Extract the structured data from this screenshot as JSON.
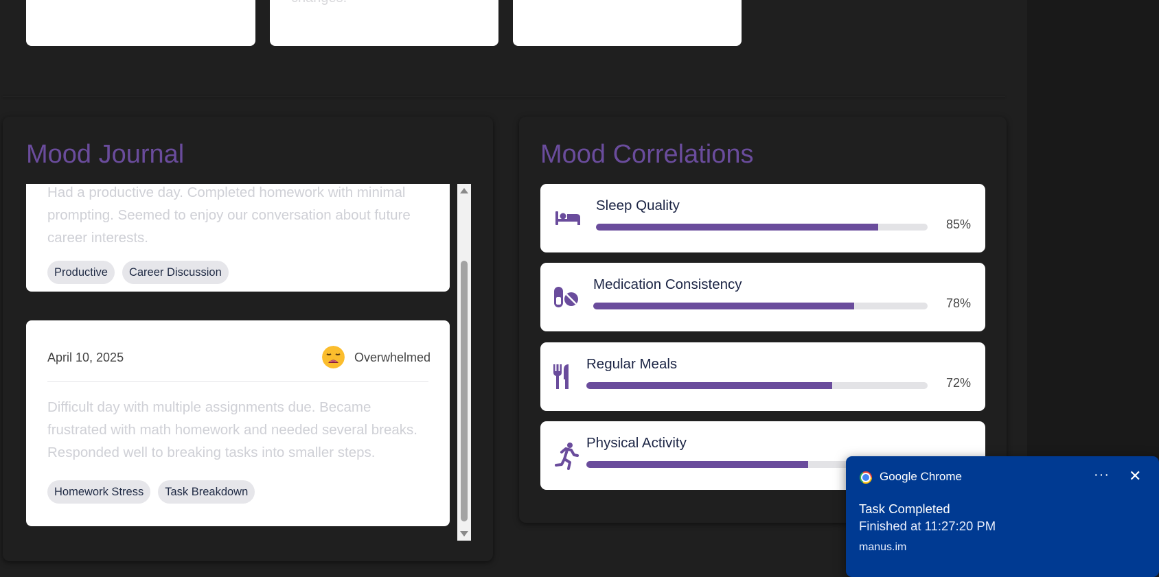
{
  "top_cards": {
    "clip_text": "changes."
  },
  "journal": {
    "title": "Mood Journal",
    "entries": [
      {
        "text": "Had a productive day. Completed homework with minimal prompting. Seemed to enjoy our conversation about future career interests.",
        "tags": [
          "Productive",
          "Career Discussion"
        ]
      },
      {
        "date": "April 10, 2025",
        "mood": "Overwhelmed",
        "text": "Difficult day with multiple assignments due. Became frustrated with math homework and needed several breaks. Responded well to breaking tasks into smaller steps.",
        "tags": [
          "Homework Stress",
          "Task Breakdown"
        ]
      }
    ]
  },
  "correlations": {
    "title": "Mood Correlations",
    "items": [
      {
        "label": "Sleep Quality",
        "percent_text": "85%",
        "value": 0.85,
        "icon": "bed-icon"
      },
      {
        "label": "Medication Consistency",
        "percent_text": "78%",
        "value": 0.78,
        "icon": "pills-icon"
      },
      {
        "label": "Regular Meals",
        "percent_text": "72%",
        "value": 0.72,
        "icon": "utensils-icon"
      },
      {
        "label": "Physical Activity",
        "value": 0.65,
        "icon": "running-icon"
      }
    ]
  },
  "notification": {
    "app": "Google Chrome",
    "title": "Task Completed",
    "body": "Finished at 11:27:20 PM",
    "source": "manus.im",
    "more": "···",
    "close": "✕"
  },
  "colors": {
    "accent": "#6a4c9c",
    "background": "#1f1f1f",
    "toast": "#003a92"
  }
}
